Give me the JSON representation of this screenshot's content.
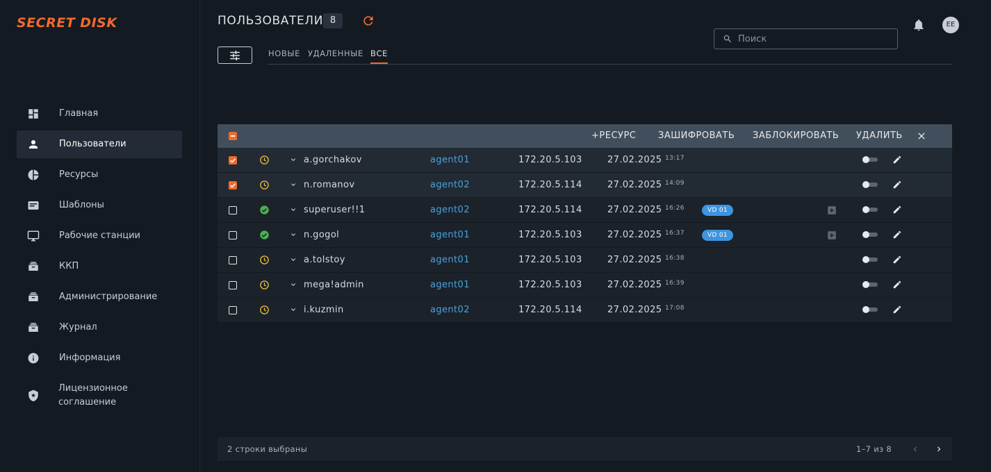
{
  "app": {
    "logo_text": "SECRET DISK",
    "accent_color": "#f26a2e",
    "link_color": "#4aa3df"
  },
  "sidebar": {
    "items": [
      {
        "label": "Главная",
        "icon": "dashboard-icon",
        "active": false
      },
      {
        "label": "Пользователи",
        "icon": "person-icon",
        "active": true
      },
      {
        "label": "Ресурсы",
        "icon": "pie-chart-icon",
        "active": false
      },
      {
        "label": "Шаблоны",
        "icon": "template-icon",
        "active": false
      },
      {
        "label": "Рабочие станции",
        "icon": "monitor-icon",
        "active": false
      },
      {
        "label": "ККП",
        "icon": "inbox-icon",
        "active": false
      },
      {
        "label": "Администрирование",
        "icon": "inbox-icon",
        "active": false
      },
      {
        "label": "Журнал",
        "icon": "inbox-icon",
        "active": false
      },
      {
        "label": "Информация",
        "icon": "info-icon",
        "active": false
      },
      {
        "label": "Лицензионное соглашение",
        "icon": "shield-icon",
        "active": false
      }
    ]
  },
  "header": {
    "title": "ПОЛЬЗОВАТЕЛИ",
    "count": "8",
    "avatar_initials": "EE",
    "search_placeholder": "Поиск",
    "search_value": ""
  },
  "tabs": [
    {
      "label": "НОВЫЕ",
      "active": false
    },
    {
      "label": "УДАЛЕННЫЕ",
      "active": false
    },
    {
      "label": "ВСЕ",
      "active": true
    }
  ],
  "toolbar": {
    "add_resource": "+РЕСУРС",
    "encrypt": "ЗАШИФРОВАТЬ",
    "block": "ЗАБЛОКИРОВАТЬ",
    "delete": "УДАЛИТЬ"
  },
  "rows": [
    {
      "checked": true,
      "status": "pending",
      "name": "a.gorchakov",
      "agent": "agent01",
      "ip": "172.20.5.103",
      "date": "27.02.2025",
      "time": "13:17",
      "vd": "",
      "play": false
    },
    {
      "checked": true,
      "status": "pending",
      "name": "n.romanov",
      "agent": "agent02",
      "ip": "172.20.5.114",
      "date": "27.02.2025",
      "time": "14:09",
      "vd": "",
      "play": false
    },
    {
      "checked": false,
      "status": "ok",
      "name": "superuser!!1",
      "agent": "agent02",
      "ip": "172.20.5.114",
      "date": "27.02.2025",
      "time": "16:26",
      "vd": "VD 01",
      "play": true
    },
    {
      "checked": false,
      "status": "ok",
      "name": "n.gogol",
      "agent": "agent01",
      "ip": "172.20.5.103",
      "date": "27.02.2025",
      "time": "16:37",
      "vd": "VD 01",
      "play": true
    },
    {
      "checked": false,
      "status": "pending",
      "name": "a.tolstoy",
      "agent": "agent01",
      "ip": "172.20.5.103",
      "date": "27.02.2025",
      "time": "16:38",
      "vd": "",
      "play": false
    },
    {
      "checked": false,
      "status": "pending",
      "name": "mega!admin",
      "agent": "agent01",
      "ip": "172.20.5.103",
      "date": "27.02.2025",
      "time": "16:39",
      "vd": "",
      "play": false
    },
    {
      "checked": false,
      "status": "pending",
      "name": "i.kuzmin",
      "agent": "agent02",
      "ip": "172.20.5.114",
      "date": "27.02.2025",
      "time": "17:08",
      "vd": "",
      "play": false
    }
  ],
  "footer": {
    "selected_text": "2 строки выбраны",
    "range_text": "1–7 из 8"
  }
}
